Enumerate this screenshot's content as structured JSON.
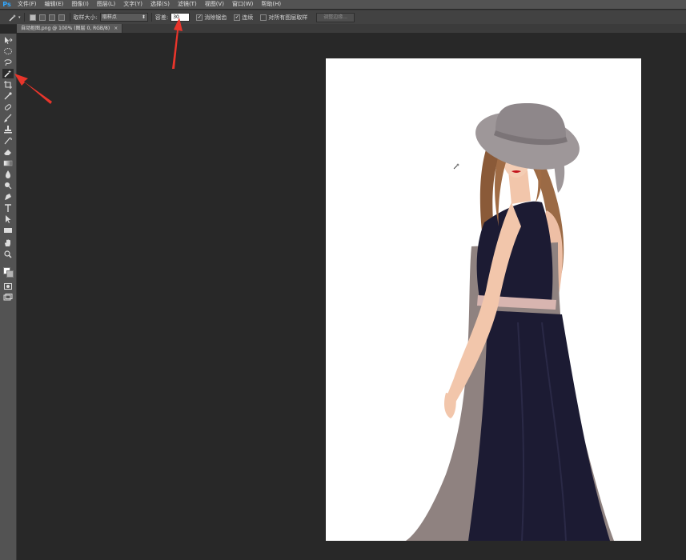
{
  "app": {
    "logo": "Ps"
  },
  "menubar": {
    "items": [
      {
        "label": "文件(F)"
      },
      {
        "label": "编辑(E)"
      },
      {
        "label": "图像(I)"
      },
      {
        "label": "图层(L)"
      },
      {
        "label": "文字(Y)"
      },
      {
        "label": "选择(S)"
      },
      {
        "label": "滤镜(T)"
      },
      {
        "label": "视图(V)"
      },
      {
        "label": "窗口(W)"
      },
      {
        "label": "帮助(H)"
      }
    ]
  },
  "options": {
    "sample_size_label": "取样大小:",
    "sample_size_value": "取样点",
    "tolerance_label": "容差:",
    "tolerance_value": "30",
    "antialias_label": "消除锯齿",
    "contiguous_label": "连续",
    "sample_all_label": "对所有图层取样",
    "refine_edge_label": "调整边缘..."
  },
  "document": {
    "tab_title": "自动抠图.png @ 100% (图层 0, RGB/8)",
    "close_glyph": "×"
  },
  "colors": {
    "accent": "#31a8ff",
    "arrow": "#e8352b",
    "dress_navy": "#1c1b33",
    "dress_taupe": "#8f8280",
    "hat_gray": "#9e9799"
  }
}
